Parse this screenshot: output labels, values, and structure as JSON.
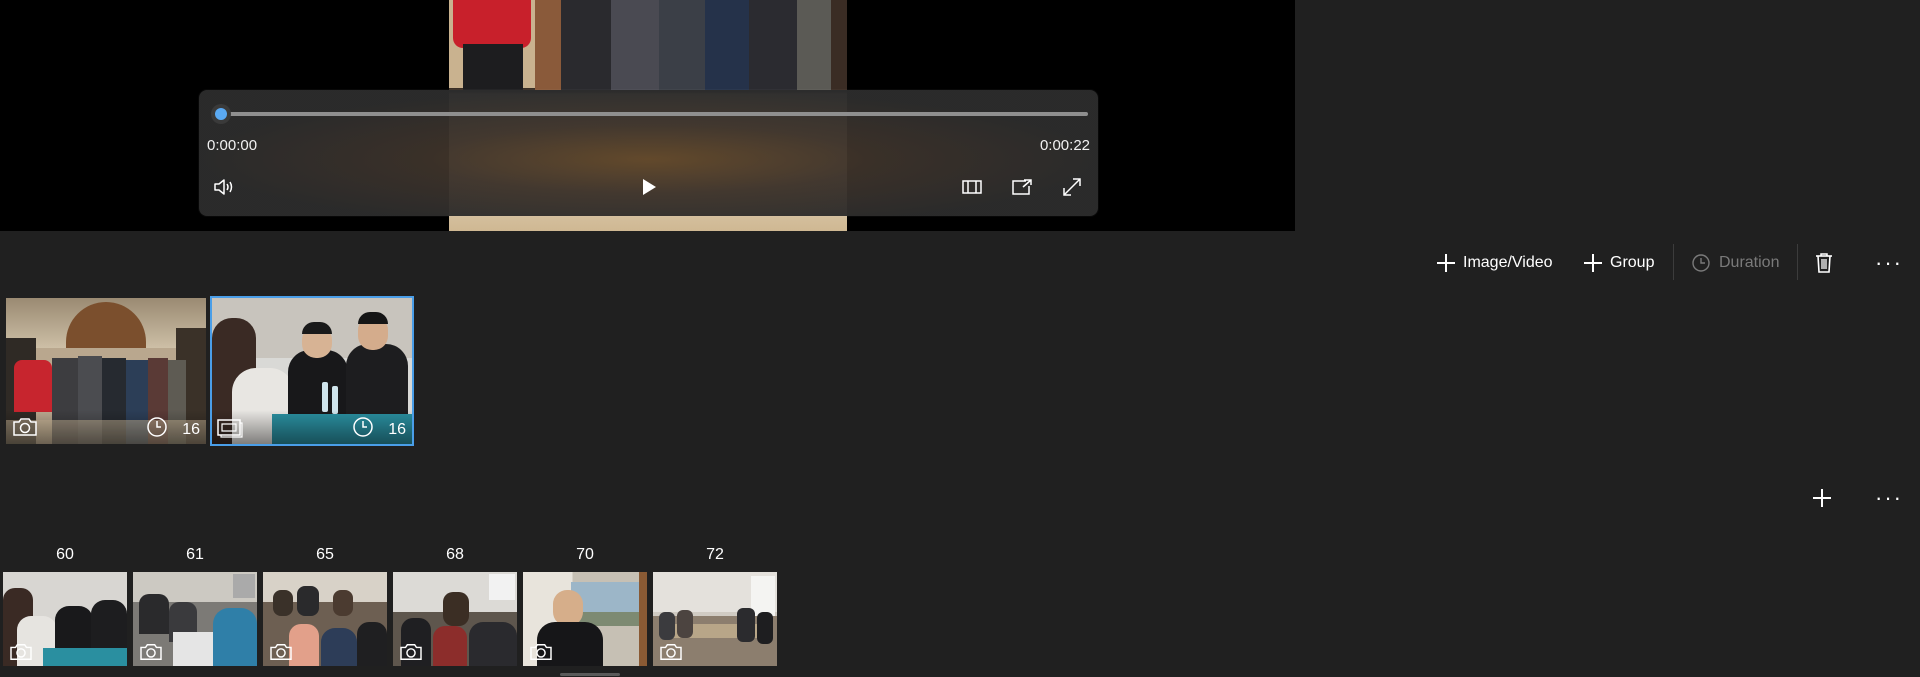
{
  "player": {
    "current_time": "0:00:00",
    "total_time": "0:00:22",
    "progress": 0.0
  },
  "toolbar": {
    "add_media_label": "Image/Video",
    "add_group_label": "Group",
    "duration_label": "Duration"
  },
  "storyboard": {
    "cards": [
      {
        "duration": "16",
        "type_icon": "camera-icon",
        "selected": false
      },
      {
        "duration": "16",
        "type_icon": "slideshow-icon",
        "selected": true
      }
    ]
  },
  "library": {
    "items": [
      {
        "label": "60"
      },
      {
        "label": "61"
      },
      {
        "label": "65"
      },
      {
        "label": "68"
      },
      {
        "label": "70"
      },
      {
        "label": "72"
      }
    ]
  },
  "colors": {
    "background": "#202020",
    "accent": "#4a9ee8",
    "seek_thumb": "#5aa9f2",
    "disabled_text": "#7a7a7a"
  }
}
